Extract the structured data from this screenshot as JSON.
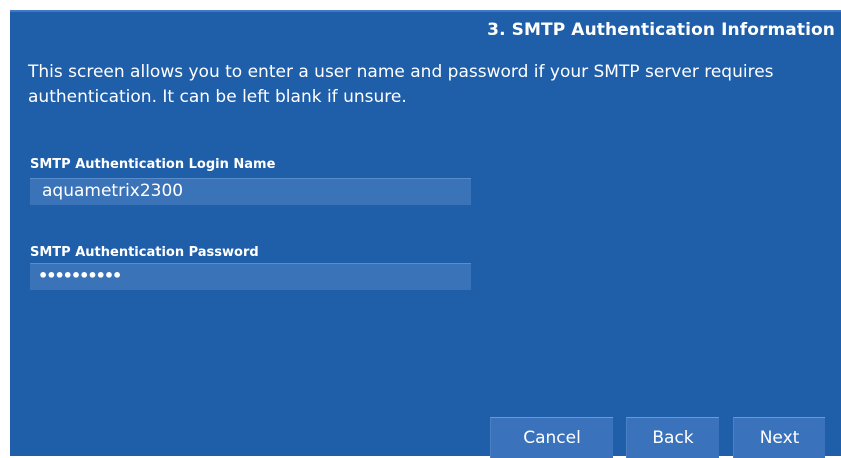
{
  "header": {
    "title": "3. SMTP Authentication Information"
  },
  "description": "This screen allows you to enter a user name and password if your SMTP server requires authentication. It can be left blank if unsure.",
  "login": {
    "label": "SMTP Authentication Login Name",
    "value": "aquametrix2300"
  },
  "password": {
    "label": "SMTP Authentication Password",
    "masked_value": "••••••••••"
  },
  "buttons": {
    "cancel": "Cancel",
    "back": "Back",
    "next": "Next"
  }
}
